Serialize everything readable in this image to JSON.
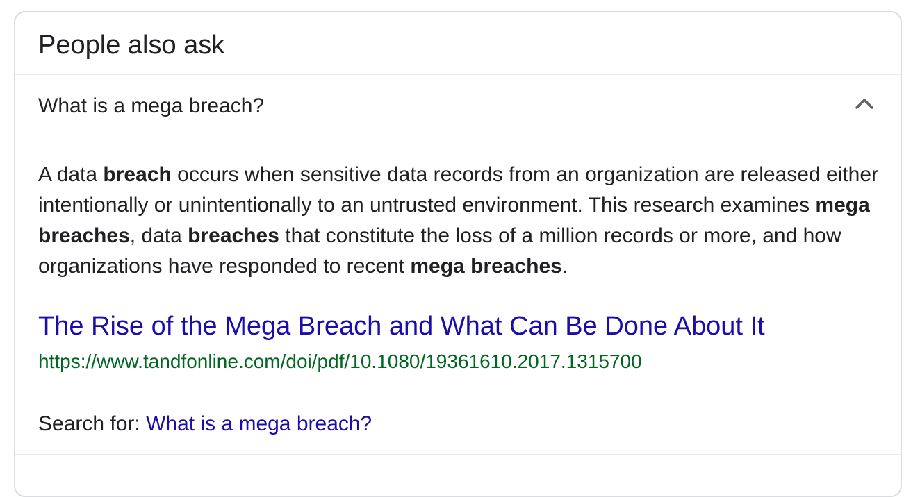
{
  "panel": {
    "title": "People also ask"
  },
  "question": {
    "text": "What is a mega breach?",
    "expand_icon": "chevron-up-icon"
  },
  "answer": {
    "segments": [
      {
        "text": "A data ",
        "bold": false
      },
      {
        "text": "breach",
        "bold": true
      },
      {
        "text": " occurs when sensitive data records from an organization are released either intentionally or unintentionally to an untrusted environment. This research examines ",
        "bold": false
      },
      {
        "text": "mega breaches",
        "bold": true
      },
      {
        "text": ", data ",
        "bold": false
      },
      {
        "text": "breaches",
        "bold": true
      },
      {
        "text": " that constitute the loss of a million records or more, and how organizations have responded to recent ",
        "bold": false
      },
      {
        "text": "mega breaches",
        "bold": true
      },
      {
        "text": ".",
        "bold": false
      }
    ]
  },
  "result": {
    "title": "The Rise of the Mega Breach and What Can Be Done About It",
    "url": "https://www.tandfonline.com/doi/pdf/10.1080/19361610.2017.1315700"
  },
  "search_for": {
    "label": "Search for: ",
    "query": "What is a mega breach?"
  },
  "colors": {
    "link": "#1a0dab",
    "url": "#006621",
    "text": "#202124",
    "border": "#dadce0"
  }
}
